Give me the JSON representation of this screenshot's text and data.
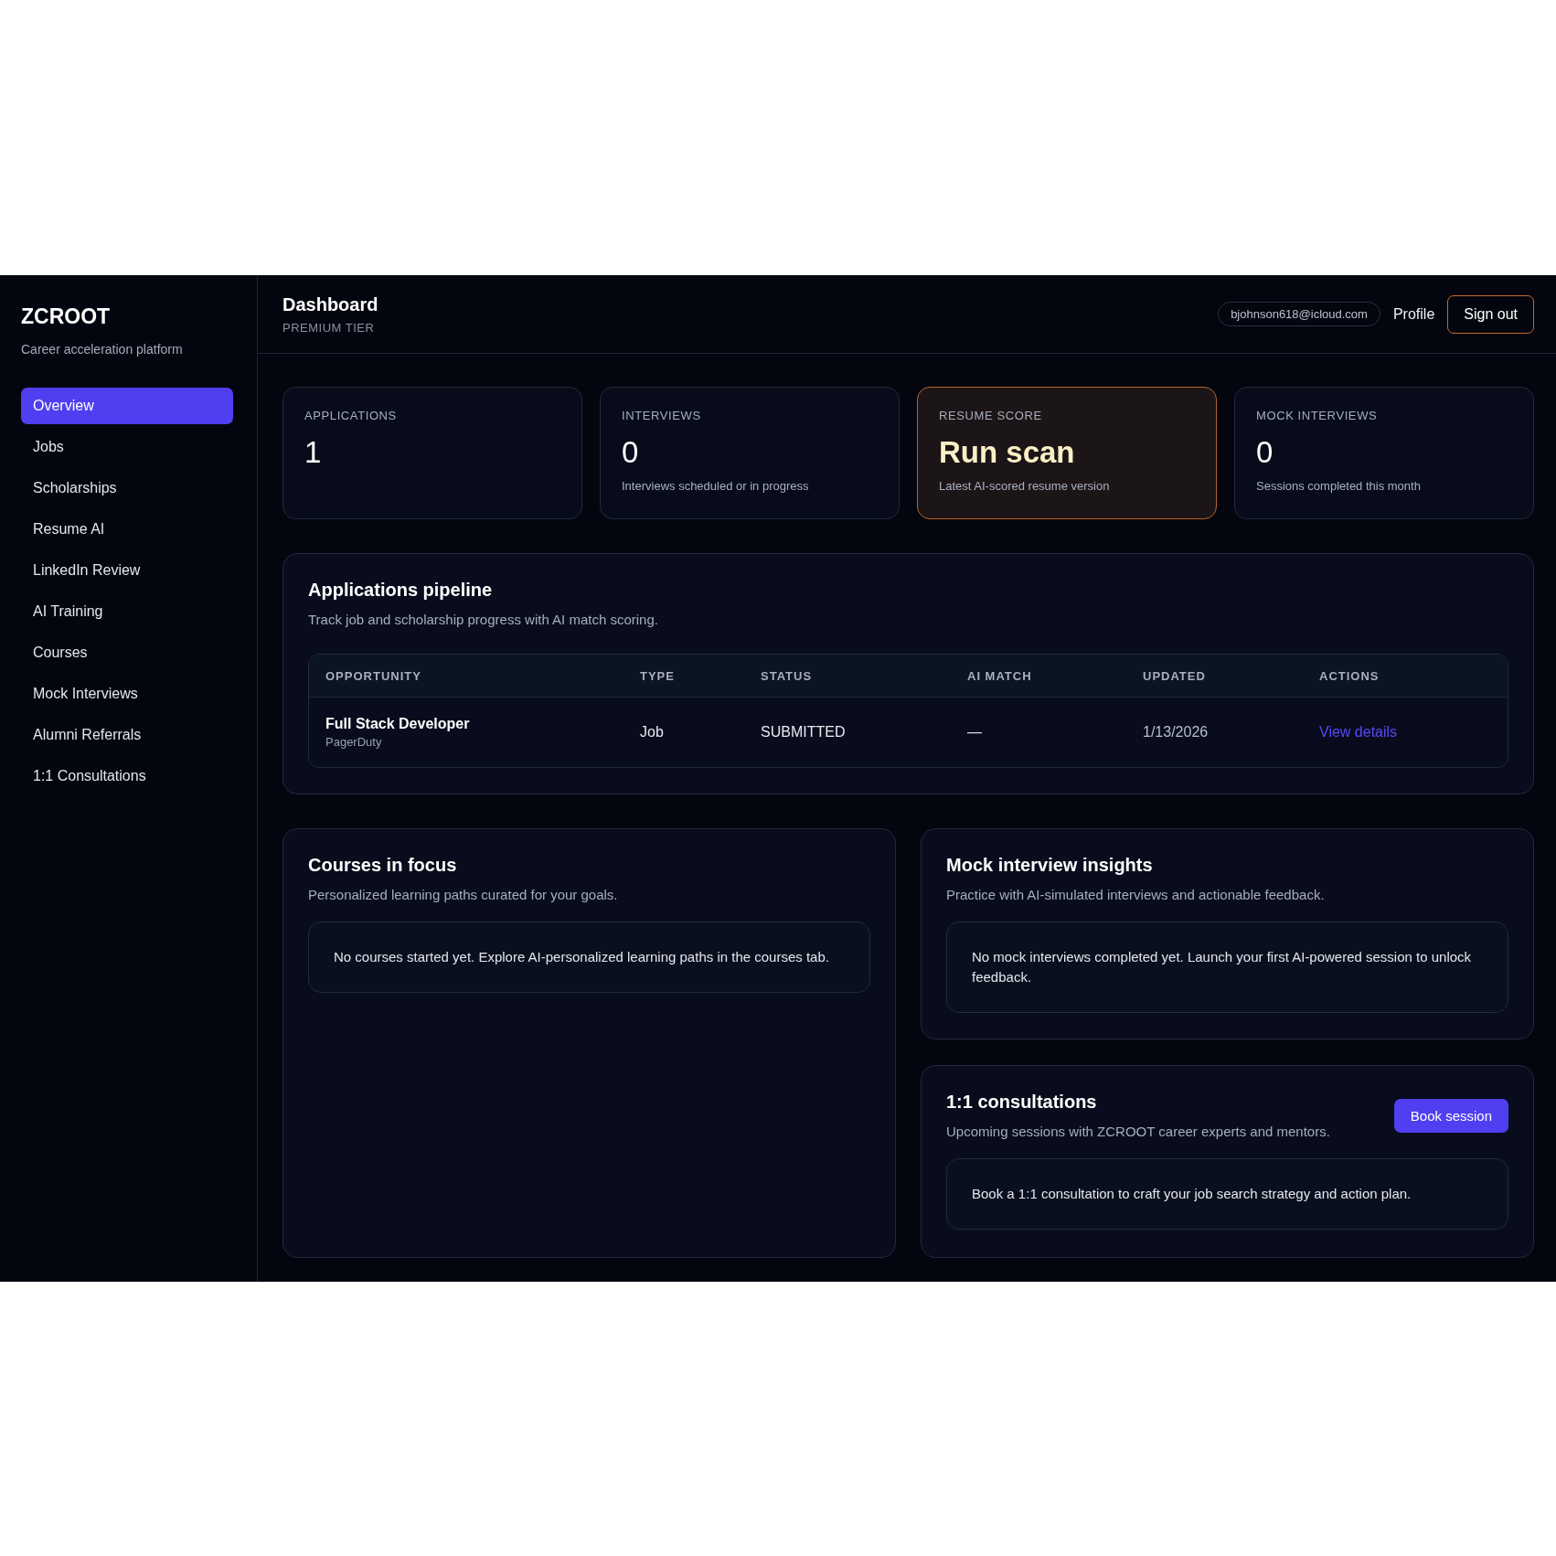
{
  "sidebar": {
    "brand": "ZCROOT",
    "tagline": "Career acceleration platform",
    "items": [
      {
        "label": "Overview",
        "selected": true
      },
      {
        "label": "Jobs",
        "selected": false
      },
      {
        "label": "Scholarships",
        "selected": false
      },
      {
        "label": "Resume AI",
        "selected": false
      },
      {
        "label": "LinkedIn Review",
        "selected": false
      },
      {
        "label": "AI Training",
        "selected": false
      },
      {
        "label": "Courses",
        "selected": false
      },
      {
        "label": "Mock Interviews",
        "selected": false
      },
      {
        "label": "Alumni Referrals",
        "selected": false
      },
      {
        "label": "1:1 Consultations",
        "selected": false
      }
    ]
  },
  "header": {
    "title": "Dashboard",
    "subtitle": "PREMIUM TIER",
    "email": "bjohnson618@icloud.com",
    "profile": "Profile",
    "sign_out": "Sign out"
  },
  "stats": [
    {
      "label": "APPLICATIONS",
      "value": "1",
      "highlighted": false
    },
    {
      "label": "INTERVIEWS",
      "value": "0",
      "note": "Interviews scheduled or in progress",
      "highlighted": false
    },
    {
      "label": "RESUME SCORE",
      "value": "Run scan",
      "note": "Latest AI-scored resume version",
      "highlighted": true
    },
    {
      "label": "MOCK INTERVIEWS",
      "value": "0",
      "note": "Sessions completed this month",
      "highlighted": false
    }
  ],
  "pipeline": {
    "title": "Applications pipeline",
    "subtitle": "Track job and scholarship progress with AI match scoring.",
    "columns": [
      "OPPORTUNITY",
      "TYPE",
      "STATUS",
      "AI MATCH",
      "UPDATED",
      "ACTIONS"
    ],
    "rows": [
      {
        "opportunity": "Full Stack Developer",
        "company": "PagerDuty",
        "type": "Job",
        "status": "SUBMITTED",
        "ai_match": "—",
        "updated": "1/13/2026",
        "action": "View details"
      }
    ]
  },
  "courses": {
    "title": "Courses in focus",
    "subtitle": "Personalized learning paths curated for your goals.",
    "empty": "No courses started yet. Explore AI-personalized learning paths in the courses tab."
  },
  "mock": {
    "title": "Mock interview insights",
    "subtitle": "Practice with AI-simulated interviews and actionable feedback.",
    "empty": "No mock interviews completed yet. Launch your first AI-powered session to unlock feedback."
  },
  "consultations": {
    "title": "1:1 consultations",
    "subtitle": "Upcoming sessions with ZCROOT career experts and mentors.",
    "button": "Book session",
    "empty": "Book a 1:1 consultation to craft your job search strategy and action plan."
  }
}
